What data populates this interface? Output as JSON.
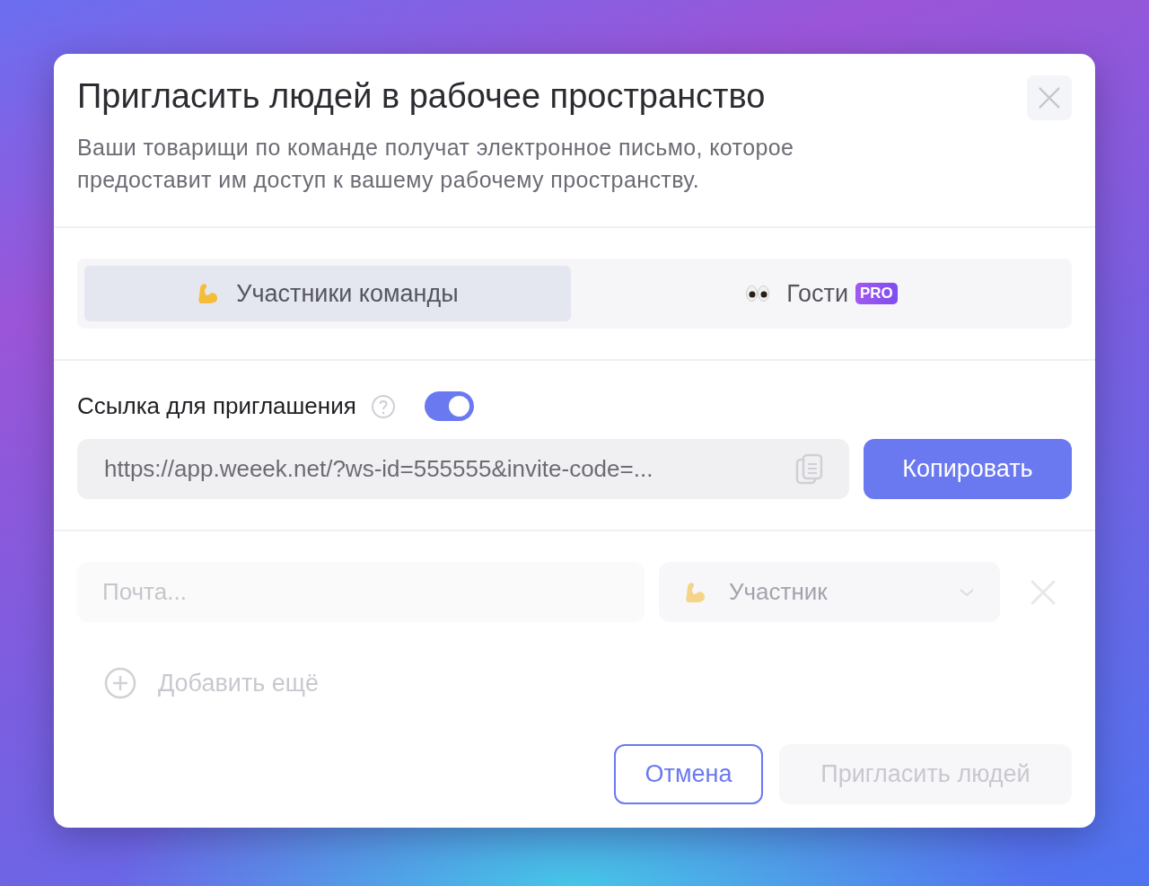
{
  "dialog": {
    "title": "Пригласить людей в рабочее пространство",
    "subtitle": "Ваши товарищи по команде получат электронное письмо, которое предоставит им доступ к вашему рабочему пространству."
  },
  "tabs": [
    {
      "label": "Участники команды",
      "kind": "arm",
      "selected": true
    },
    {
      "label": "Гости",
      "kind": "eyes",
      "selected": false,
      "badge": "PRO"
    }
  ],
  "invite_link": {
    "label": "Ссылка для приглашения",
    "on": true,
    "url": "https://app.weeek.net/?ws-id=555555&invite-code=...",
    "copy_button": "Копировать"
  },
  "invites": [
    {
      "email_placeholder": "Почта...",
      "role": "Участник"
    }
  ],
  "add_more": "Добавить ещё",
  "buttons": {
    "cancel": "Отмена",
    "submit": {
      "label": "Пригласить людей",
      "disabled": true
    }
  }
}
